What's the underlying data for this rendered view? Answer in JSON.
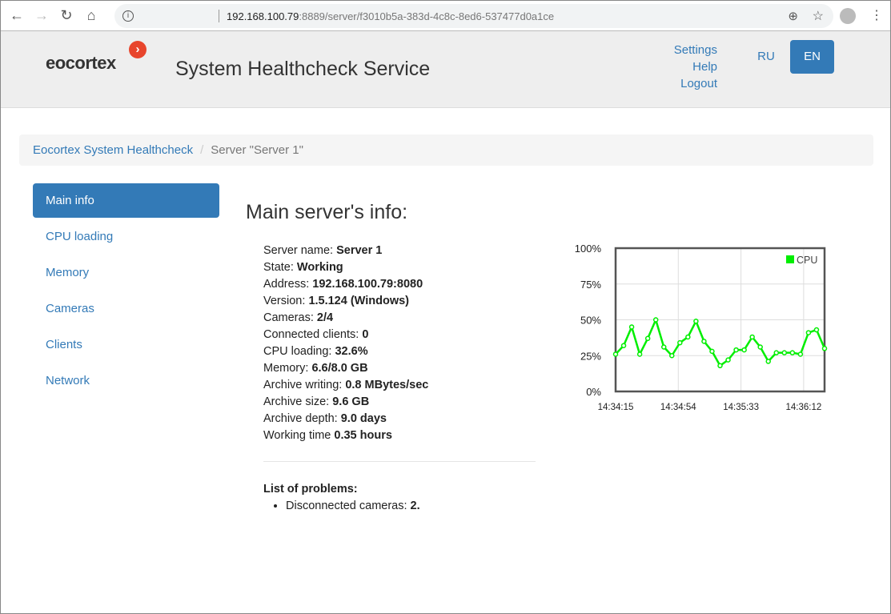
{
  "browser": {
    "url_host": "192.168.100.79",
    "url_rest": ":8889/server/f3010b5a-383d-4c8c-8ed6-537477d0a1ce"
  },
  "header": {
    "logo": "eocortex",
    "title": "System Healthcheck Service",
    "links": [
      "Settings",
      "Help",
      "Logout"
    ],
    "lang_ru": "RU",
    "lang_en": "EN",
    "active_lang": "EN",
    "accent": "#337ab7"
  },
  "breadcrumb": {
    "home": "Eocortex System Healthcheck",
    "divider": "/",
    "current": "Server \"Server 1\""
  },
  "sidebar": {
    "items": [
      {
        "label": "Main info",
        "active": true
      },
      {
        "label": "CPU loading"
      },
      {
        "label": "Memory"
      },
      {
        "label": "Cameras"
      },
      {
        "label": "Clients"
      },
      {
        "label": "Network"
      }
    ]
  },
  "main": {
    "heading": "Main server's info:",
    "info": [
      {
        "label": "Server name:",
        "value": "Server 1"
      },
      {
        "label": "State:",
        "value": "Working"
      },
      {
        "label": "Address:",
        "value": "192.168.100.79:8080"
      },
      {
        "label": "Version:",
        "value": "1.5.124 (Windows)"
      },
      {
        "label": "Cameras:",
        "value": "2/4"
      },
      {
        "label": "Connected clients:",
        "value": "0"
      },
      {
        "label": "CPU loading:",
        "value": "32.6%"
      },
      {
        "label": "Memory:",
        "value": "6.6/8.0 GB"
      },
      {
        "label": "Archive writing:",
        "value": "0.8 MBytes/sec"
      },
      {
        "label": "Archive size:",
        "value": "9.6 GB"
      },
      {
        "label": "Archive depth:",
        "value": "9.0 days"
      },
      {
        "label": "Working time",
        "value": "0.35 hours"
      }
    ],
    "problems_title": "List of problems:",
    "problems": [
      {
        "label": "Disconnected cameras:",
        "value": "2."
      }
    ]
  },
  "chart_data": {
    "type": "line",
    "legend": "CPU",
    "legend_position": "top-right",
    "color": "#00ee00",
    "grid": true,
    "y_ticks": [
      "0%",
      "25%",
      "50%",
      "75%",
      "100%"
    ],
    "ylim": [
      0,
      100
    ],
    "x_ticks": [
      "14:34:15",
      "14:34:54",
      "14:35:33",
      "14:36:12"
    ],
    "xlim": [
      "14:34:15",
      "14:36:25"
    ],
    "x": [
      "14:34:15",
      "14:34:20",
      "14:34:25",
      "14:34:30",
      "14:34:35",
      "14:34:40",
      "14:34:45",
      "14:34:50",
      "14:34:55",
      "14:35:00",
      "14:35:05",
      "14:35:10",
      "14:35:15",
      "14:35:20",
      "14:35:25",
      "14:35:30",
      "14:35:35",
      "14:35:40",
      "14:35:45",
      "14:35:50",
      "14:35:55",
      "14:36:00",
      "14:36:05",
      "14:36:10",
      "14:36:15",
      "14:36:20",
      "14:36:25"
    ],
    "values": [
      26,
      32,
      45,
      26,
      37,
      50,
      31,
      25,
      34,
      38,
      49,
      35,
      28,
      18,
      22,
      29,
      29,
      38,
      31,
      21,
      27,
      27,
      27,
      26,
      41,
      43,
      30
    ]
  }
}
